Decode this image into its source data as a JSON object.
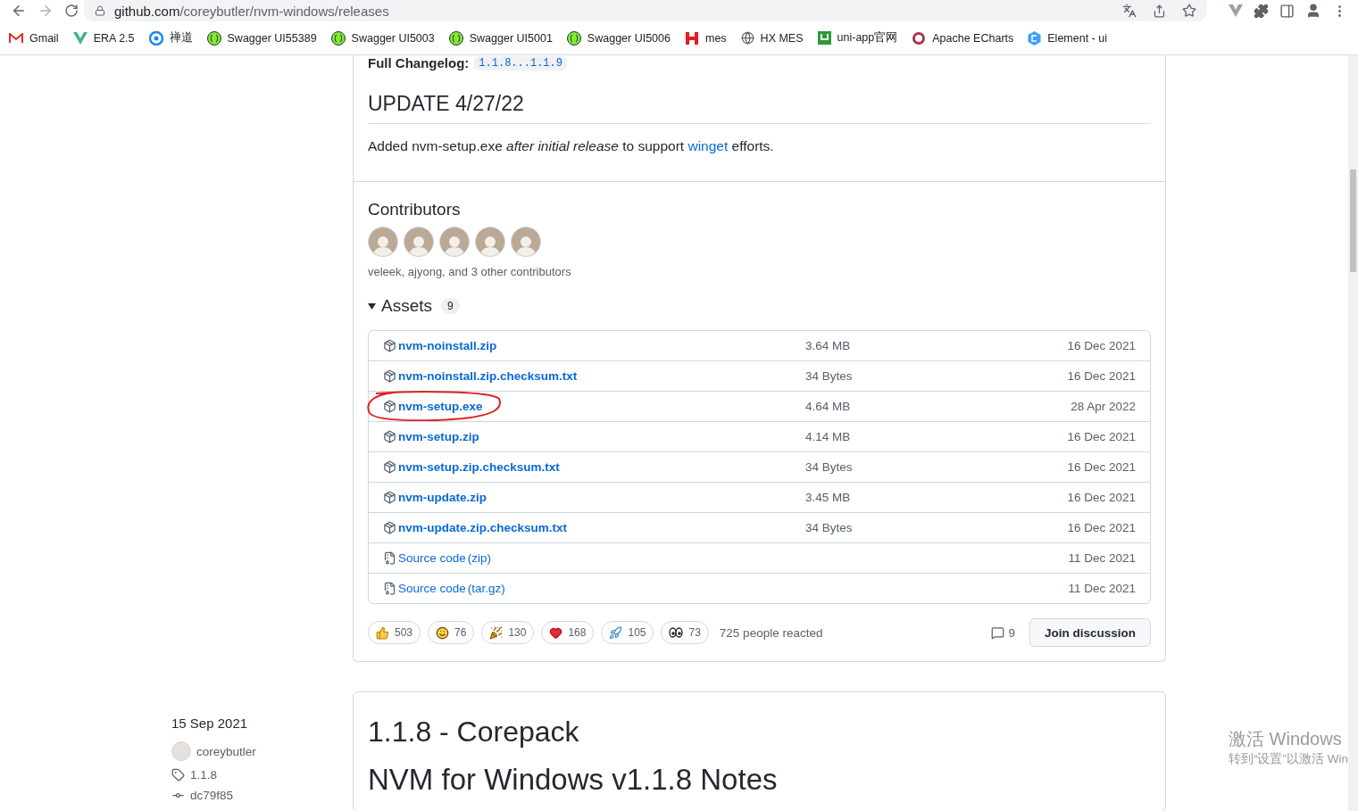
{
  "browser": {
    "url_host": "github.com",
    "url_path": "/coreybutler/nvm-windows/releases",
    "bookmarks": [
      {
        "label": "Gmail",
        "kind": "mail"
      },
      {
        "label": "ERA 2.5",
        "kind": "vee"
      },
      {
        "label": "禅道",
        "kind": "swirl"
      },
      {
        "label": "Swagger UI55389",
        "kind": "swagger"
      },
      {
        "label": "Swagger UI5003",
        "kind": "swagger"
      },
      {
        "label": "Swagger UI5001",
        "kind": "swagger"
      },
      {
        "label": "Swagger UI5006",
        "kind": "swagger"
      },
      {
        "label": "mes",
        "kind": "hbar"
      },
      {
        "label": "HX MES",
        "kind": "globe"
      },
      {
        "label": "uni-app官网",
        "kind": "square"
      },
      {
        "label": "Apache ECharts",
        "kind": "ring"
      },
      {
        "label": "Element - ui",
        "kind": "hex"
      }
    ]
  },
  "release": {
    "changelog_label": "Full Changelog:",
    "changelog_link": "1.1.8...1.1.9",
    "update_heading": "UPDATE 4/27/22",
    "update_text": "Added nvm-setup.exe *after initial release* to support ",
    "update_link": "winget",
    "update_tail": " efforts.",
    "contributors_heading": "Contributors",
    "contributors_text": "veleek, ajyong, and 3 other contributors",
    "assets_heading": "Assets",
    "assets_count": "9",
    "assets_expanded": true,
    "assets": [
      {
        "name": "nvm-noinstall.zip",
        "kind": "package",
        "size": "3.64 MB",
        "date": "16 Dec 2021",
        "circled": false
      },
      {
        "name": "nvm-noinstall.zip.checksum.txt",
        "kind": "package",
        "size": "34 Bytes",
        "date": "16 Dec 2021",
        "circled": false
      },
      {
        "name": "nvm-setup.exe",
        "kind": "package",
        "size": "4.64 MB",
        "date": "28 Apr 2022",
        "circled": true
      },
      {
        "name": "nvm-setup.zip",
        "kind": "package",
        "size": "4.14 MB",
        "date": "16 Dec 2021",
        "circled": false
      },
      {
        "name": "nvm-setup.zip.checksum.txt",
        "kind": "package",
        "size": "34 Bytes",
        "date": "16 Dec 2021",
        "circled": false
      },
      {
        "name": "nvm-update.zip",
        "kind": "package",
        "size": "3.45 MB",
        "date": "16 Dec 2021",
        "circled": false
      },
      {
        "name": "nvm-update.zip.checksum.txt",
        "kind": "package",
        "size": "34 Bytes",
        "date": "16 Dec 2021",
        "circled": false
      },
      {
        "name": "Source code",
        "suffix": " (zip)",
        "kind": "source",
        "date": "11 Dec 2021",
        "circled": false
      },
      {
        "name": "Source code",
        "suffix": " (tar.gz)",
        "kind": "source",
        "date": "11 Dec 2021",
        "circled": false
      }
    ],
    "reactions": [
      {
        "kind": "thumbs_up",
        "count": "503"
      },
      {
        "kind": "smile",
        "count": "76"
      },
      {
        "kind": "party",
        "count": "130"
      },
      {
        "kind": "heart",
        "count": "168"
      },
      {
        "kind": "rocket",
        "count": "105"
      },
      {
        "kind": "eyes",
        "count": "73"
      }
    ],
    "reacted_text": "725 people reacted",
    "comments_count": "9",
    "discussion_button": "Join discussion"
  },
  "next_release": {
    "date": "15 Sep 2021",
    "author": "coreybutler",
    "tag": "1.1.8",
    "commit": "dc79f85",
    "title": "1.1.8 - Corepack",
    "heading": "NVM for Windows v1.1.8 Notes"
  },
  "os_overlay": {
    "title": "激活 Windows",
    "subtitle": "转到“设置”以激活 Win"
  }
}
